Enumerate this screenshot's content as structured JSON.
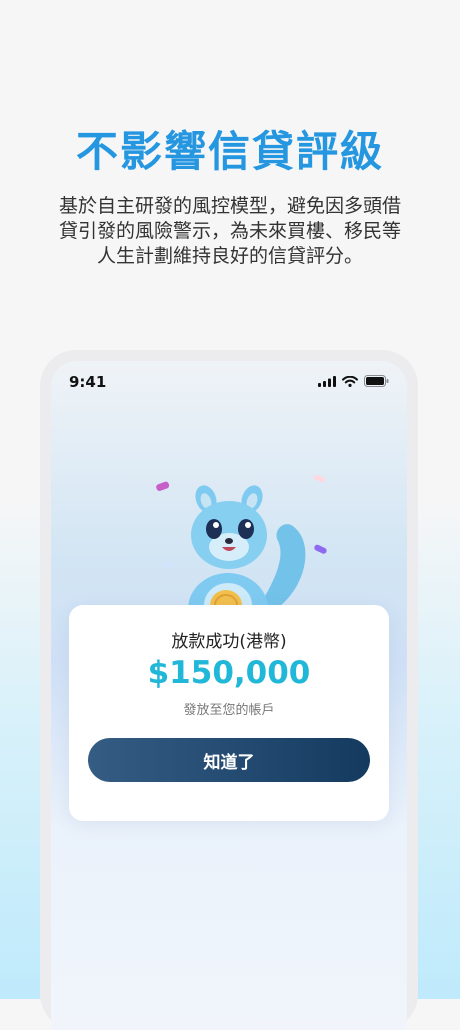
{
  "headline": "不影響信貸評級",
  "subtext": {
    "line1": "基於自主研發的風控模型，避免因多頭借",
    "line2": "貸引發的風險警示，為未來買樓、移民等",
    "line3": "人生計劃維持良好的信貸評分。"
  },
  "phone": {
    "status_time": "9:41",
    "icons": [
      "signal-icon",
      "wifi-icon",
      "battery-icon"
    ]
  },
  "card": {
    "title": "放款成功(港幣)",
    "amount": "$150,000",
    "note": "發放至您的帳戶",
    "button_label": "知道了"
  },
  "colors": {
    "headline": "#2596e0",
    "amount": "#20b7d8",
    "button": "#1c4468"
  }
}
